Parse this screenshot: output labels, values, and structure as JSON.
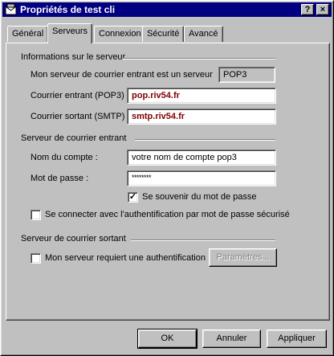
{
  "window": {
    "title": "Propriétés de test cli",
    "help_button": "?",
    "close_button": "×"
  },
  "tabs": [
    {
      "label": "Général"
    },
    {
      "label": "Serveurs"
    },
    {
      "label": "Connexion"
    },
    {
      "label": "Sécurité"
    },
    {
      "label": "Avancé"
    }
  ],
  "active_tab": "Serveurs",
  "server_info": {
    "heading": "Informations sur le serveur",
    "incoming_type_label": "Mon serveur de courrier entrant est un serveur",
    "incoming_type_value": "POP3",
    "incoming_label": "Courrier entrant (POP3) :",
    "incoming_value": "pop.riv54.fr",
    "outgoing_label": "Courrier sortant (SMTP) :",
    "outgoing_value": "smtp.riv54.fr"
  },
  "incoming_server": {
    "heading": "Serveur de courrier entrant",
    "account_label": "Nom du compte :",
    "account_value": "votre nom de compte pop3",
    "password_label": "Mot de passe :",
    "password_value": "********",
    "remember_password_label": "Se souvenir du mot de passe",
    "remember_password_checked": true,
    "spa_label": "Se connecter avec l'authentification par mot de passe sécurisé",
    "spa_checked": false
  },
  "outgoing_server": {
    "heading": "Serveur de courrier sortant",
    "auth_label": "Mon serveur requiert une authentification",
    "auth_checked": false,
    "settings_button": "Paramètres..."
  },
  "buttons": {
    "ok": "OK",
    "cancel": "Annuler",
    "apply": "Appliquer"
  },
  "colors": {
    "titlebar": "#000080",
    "face": "#c0c0c0",
    "server_text": "#800000"
  }
}
